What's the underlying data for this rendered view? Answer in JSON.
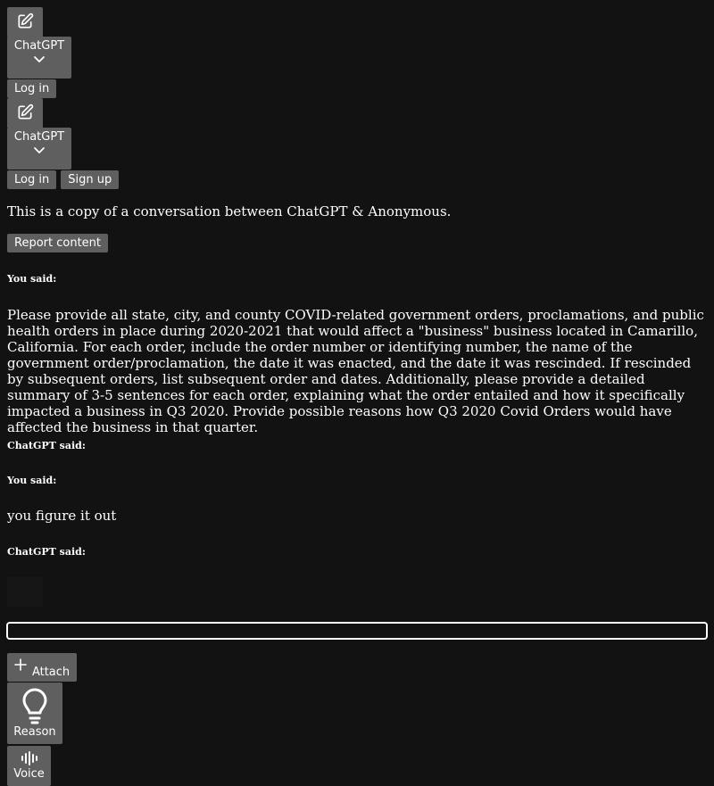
{
  "header_top": {
    "new_chat_icon": "pencil-square-icon",
    "model_label": "ChatGPT",
    "login_label": "Log in"
  },
  "header_second": {
    "new_chat_icon": "pencil-square-icon",
    "model_label": "ChatGPT",
    "login_label": "Log in",
    "signup_label": "Sign up"
  },
  "conversation": {
    "intro": "This is a copy of a conversation between ChatGPT & Anonymous.",
    "report_label": "Report content",
    "messages": [
      {
        "speaker": "You said:",
        "text": "Please provide all state, city, and county COVID-related government orders, proclamations, and public health orders in place during 2020-2021 that would affect a \"business\" business located in Camarillo, California. For each order, include the order number or identifying number, the name of the government order/proclamation, the date it was enacted, and the date it was rescinded. If rescinded by subsequent orders, list subsequent order and dates. Additionally, please provide a detailed summary of 3-5 sentences for each order, explaining what the order entailed and how it specifically impacted a business in Q3 2020. Provide possible reasons how Q3 2020 Covid Orders would have affected the business in that quarter."
      },
      {
        "speaker": "ChatGPT said:",
        "text": ""
      },
      {
        "speaker": "You said:",
        "text": "you figure it out"
      },
      {
        "speaker": "ChatGPT said:",
        "text": ""
      }
    ]
  },
  "composer": {
    "placeholder": "",
    "attach_label": "Attach",
    "attach_icon": "plus-icon",
    "reason_label": "Reason",
    "reason_icon": "lightbulb-icon",
    "voice_label": "Voice",
    "voice_icon": "waveform-icon"
  }
}
